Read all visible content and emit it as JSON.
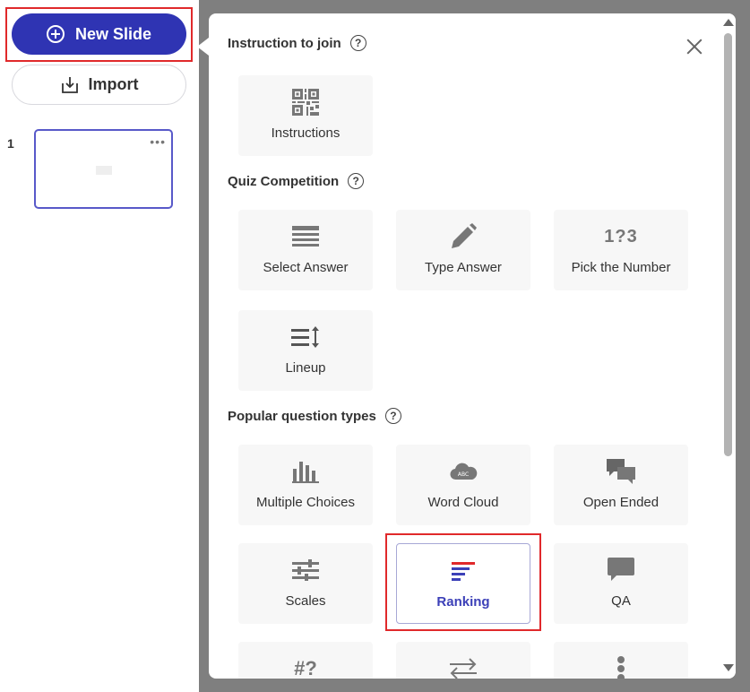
{
  "sidebar": {
    "new_slide_label": "New Slide",
    "import_label": "Import",
    "slides": [
      {
        "number": "1"
      }
    ]
  },
  "modal": {
    "sections": [
      {
        "title": "Instruction to join",
        "cards": [
          {
            "label": "Instructions",
            "icon": "qr-code-icon"
          }
        ]
      },
      {
        "title": "Quiz Competition",
        "cards": [
          {
            "label": "Select Answer",
            "icon": "list-lines-icon"
          },
          {
            "label": "Type Answer",
            "icon": "pencil-icon"
          },
          {
            "label": "Pick the Number",
            "icon": "number-icon",
            "icon_text": "1?3"
          },
          {
            "label": "Lineup",
            "icon": "lineup-icon"
          }
        ]
      },
      {
        "title": "Popular question types",
        "cards": [
          {
            "label": "Multiple Choices",
            "icon": "bar-chart-icon"
          },
          {
            "label": "Word Cloud",
            "icon": "cloud-icon",
            "icon_text": "ABC"
          },
          {
            "label": "Open Ended",
            "icon": "chat-bubbles-icon"
          },
          {
            "label": "Scales",
            "icon": "sliders-icon"
          },
          {
            "label": "Ranking",
            "icon": "ranking-icon",
            "selected": true
          },
          {
            "label": "QA",
            "icon": "speech-bubble-icon"
          },
          {
            "label": "",
            "icon": "hash-question-icon",
            "icon_text": "#?"
          },
          {
            "label": "",
            "icon": "swap-arrows-icon"
          },
          {
            "label": "",
            "icon": "vertical-dots-icon"
          }
        ]
      }
    ]
  },
  "colors": {
    "primary": "#2f34b3",
    "highlight": "#e0292b",
    "backdrop": "#7f7f7f",
    "card_bg": "#f7f7f7",
    "icon": "#777777"
  }
}
